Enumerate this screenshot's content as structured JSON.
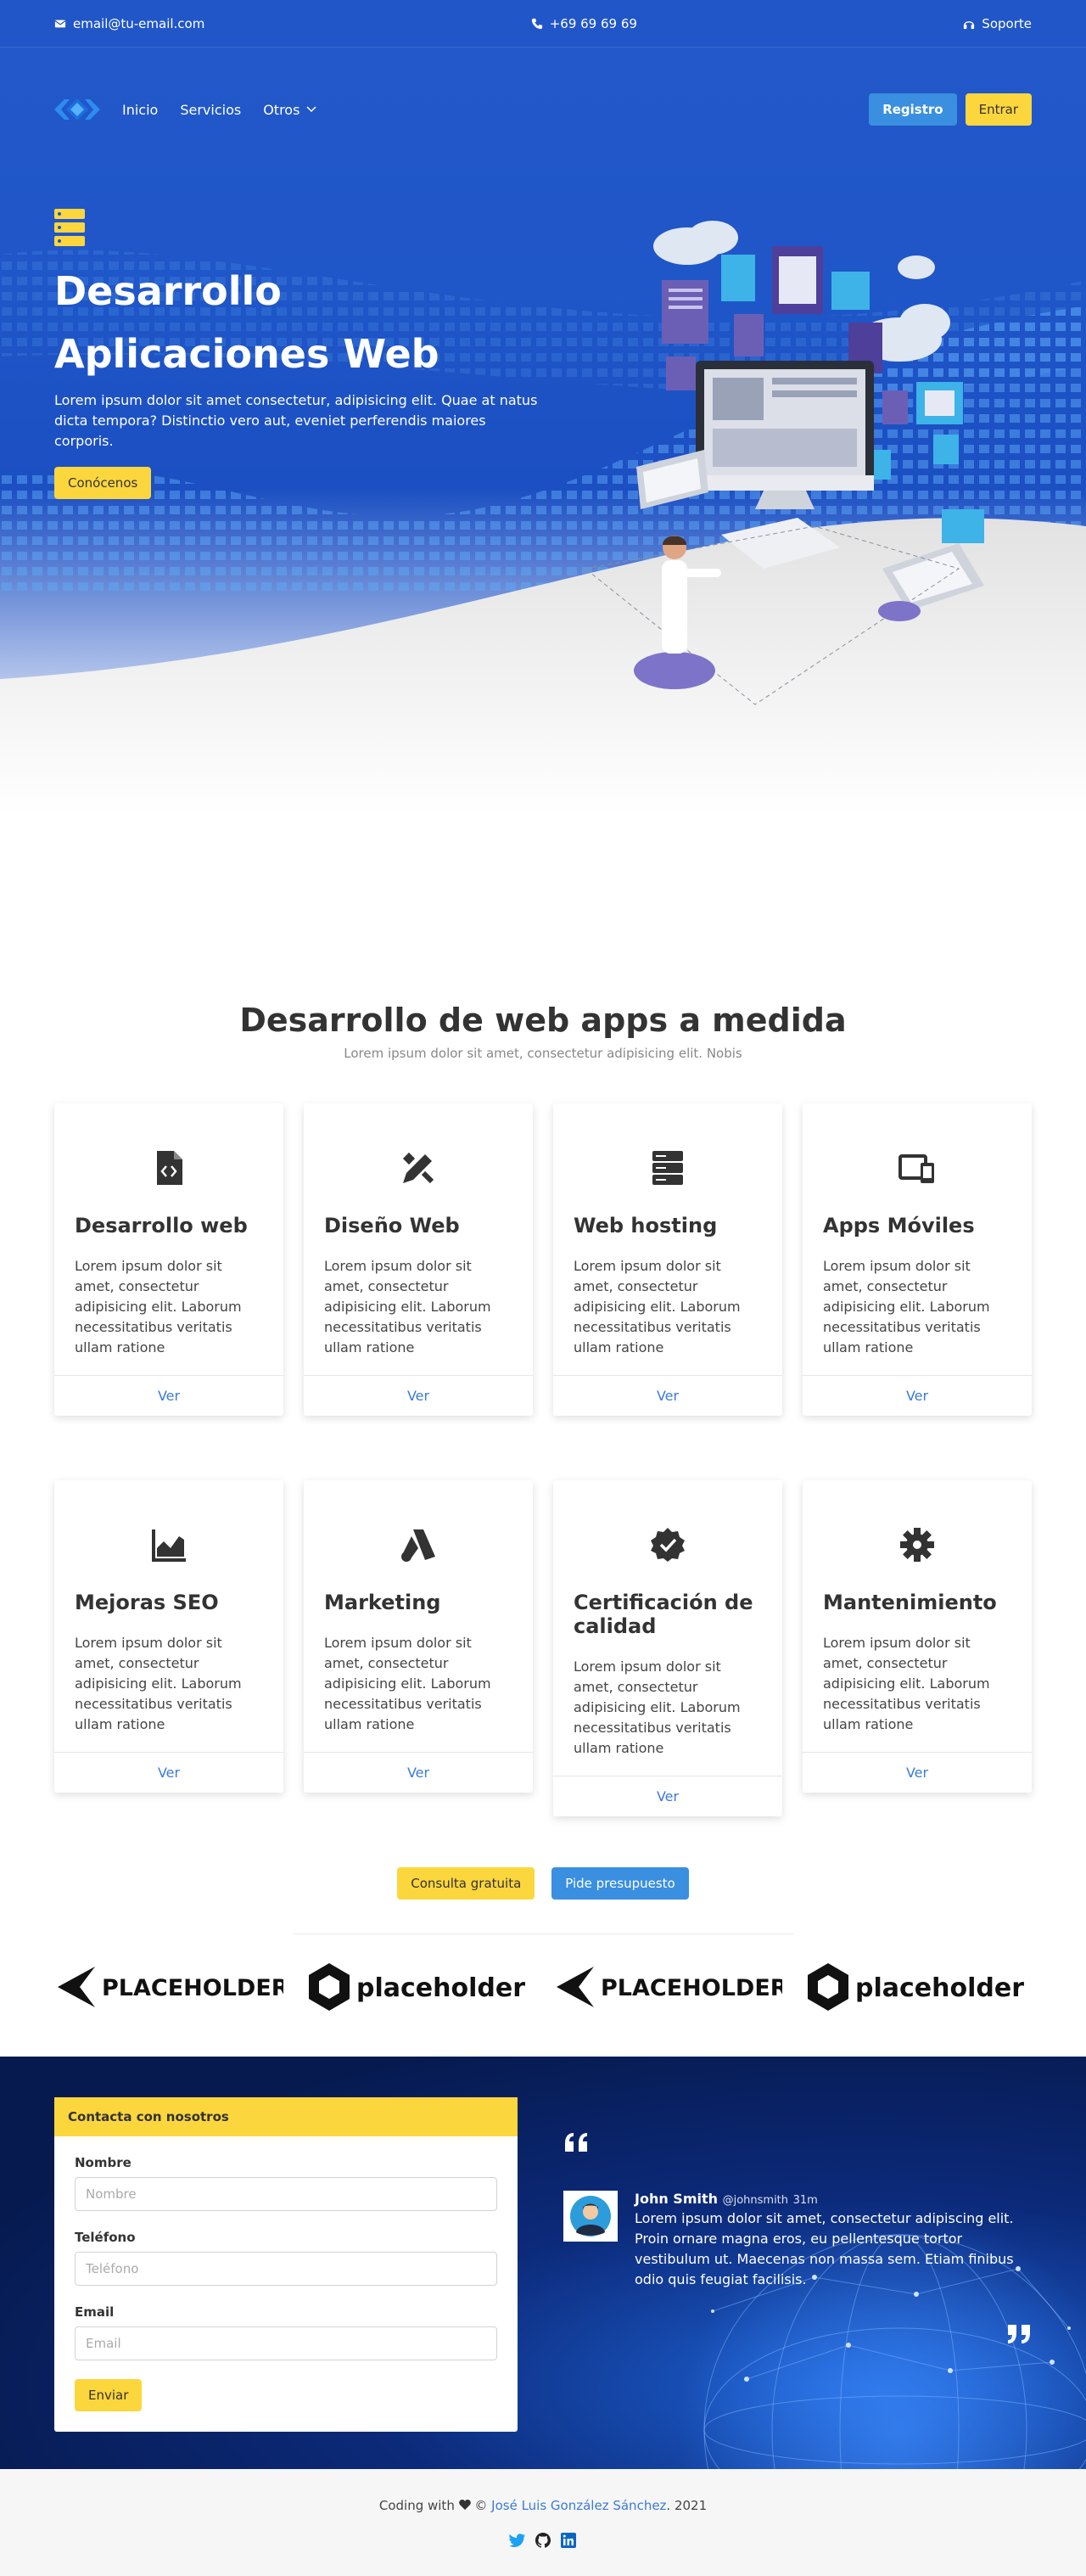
{
  "topbar": {
    "email": "email@tu-email.com",
    "phone": "+69 69 69 69",
    "support": "Soporte"
  },
  "nav": {
    "links": [
      "Inicio",
      "Servicios",
      "Otros"
    ],
    "register": "Registro",
    "login": "Entrar"
  },
  "hero": {
    "title_line1": "Desarrollo",
    "title_line2": "Aplicaciones Web",
    "text": "Lorem ipsum dolor sit amet consectetur, adipisicing elit. Quae at natus dicta tempora? Distinctio vero aut, eveniet perferendis maiores corporis.",
    "button": "Conócenos"
  },
  "services": {
    "title": "Desarrollo de web apps a medida",
    "subtitle": "Lorem ipsum dolor sit amet, consectetur adipisicing elit. Nobis",
    "cards": [
      {
        "title": "Desarrollo web",
        "text": "Lorem ipsum dolor sit amet, consectetur adipisicing elit. Laborum necessitatibus veritatis ullam ratione",
        "link": "Ver",
        "icon": "file-code-icon"
      },
      {
        "title": "Diseño Web",
        "text": "Lorem ipsum dolor sit amet, consectetur adipisicing elit. Laborum necessitatibus veritatis ullam ratione",
        "link": "Ver",
        "icon": "design-tools-icon"
      },
      {
        "title": "Web hosting",
        "text": "Lorem ipsum dolor sit amet, consectetur adipisicing elit. Laborum necessitatibus veritatis ullam ratione",
        "link": "Ver",
        "icon": "server-icon"
      },
      {
        "title": "Apps Móviles",
        "text": "Lorem ipsum dolor sit amet, consectetur adipisicing elit. Laborum necessitatibus veritatis ullam ratione",
        "link": "Ver",
        "icon": "devices-icon"
      },
      {
        "title": "Mejoras SEO",
        "text": "Lorem ipsum dolor sit amet, consectetur adipisicing elit. Laborum necessitatibus veritatis ullam ratione",
        "link": "Ver",
        "icon": "chart-icon"
      },
      {
        "title": "Marketing",
        "text": "Lorem ipsum dolor sit amet, consectetur adipisicing elit. Laborum necessitatibus veritatis ullam ratione",
        "link": "Ver",
        "icon": "adwords-icon"
      },
      {
        "title": "Certificación de calidad",
        "text": "Lorem ipsum dolor sit amet, consectetur adipisicing elit. Laborum necessitatibus veritatis ullam ratione",
        "link": "Ver",
        "icon": "badge-check-icon"
      },
      {
        "title": "Mantenimiento",
        "text": "Lorem ipsum dolor sit amet, consectetur adipisicing elit. Laborum necessitatibus veritatis ullam ratione",
        "link": "Ver",
        "icon": "gear-icon"
      }
    ],
    "cta_free": "Consulta gratuita",
    "cta_quote": "Pide presupuesto"
  },
  "logos": [
    "PLACEHOLDER",
    "placeholder",
    "PLACEHOLDER",
    "placeholder"
  ],
  "contact": {
    "header": "Contacta con nosotros",
    "fields": [
      {
        "label": "Nombre",
        "placeholder": "Nombre"
      },
      {
        "label": "Teléfono",
        "placeholder": "Teléfono"
      },
      {
        "label": "Email",
        "placeholder": "Email"
      }
    ],
    "submit": "Enviar"
  },
  "testimonial": {
    "name": "John Smith",
    "handle": "@johnsmith",
    "time": "31m",
    "text": "Lorem ipsum dolor sit amet, consectetur adipiscing elit. Proin ornare magna eros, eu pellentesque tortor vestibulum ut. Maecenas non massa sem. Etiam finibus odio quis feugiat facilisis."
  },
  "footer": {
    "prefix": "Coding with",
    "author": "José Luis González Sánchez",
    "year": ". 2021",
    "copy": "©"
  },
  "colors": {
    "primary_blue": "#2156c9",
    "accent_blue": "#3a8fe0",
    "yellow": "#fcd63d",
    "link": "#3a7bd5"
  }
}
